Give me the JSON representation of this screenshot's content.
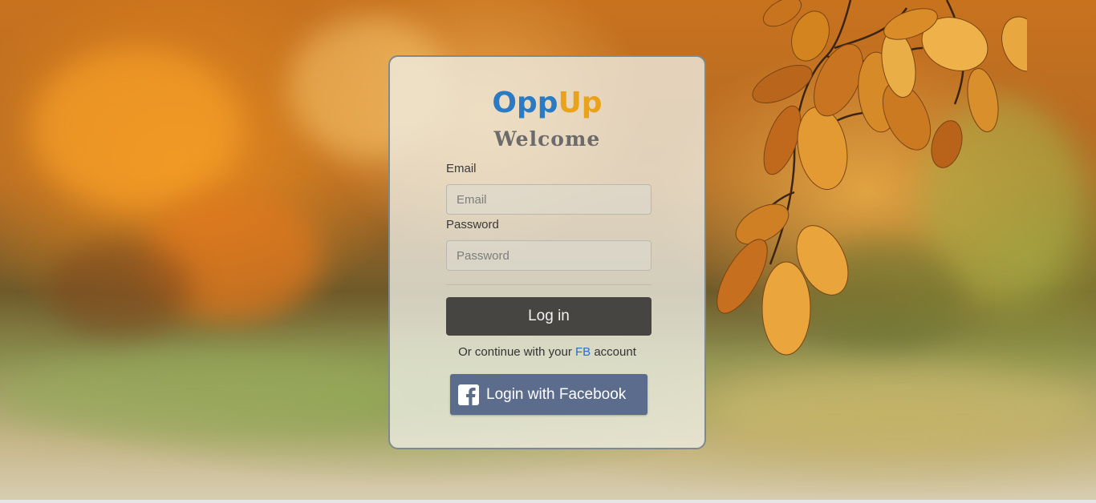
{
  "brand": {
    "part1": "Opp",
    "part2": "Up",
    "color1": "#2b7bc4",
    "color2": "#e9a21a"
  },
  "welcome": "Welcome",
  "form": {
    "email_label": "Email",
    "email_placeholder": "Email",
    "password_label": "Password",
    "password_placeholder": "Password",
    "login_label": "Log in"
  },
  "alt_login": {
    "prefix": "Or continue with your",
    "fb_link": "FB",
    "suffix": "account",
    "facebook_button": "Login with Facebook",
    "facebook_icon": "facebook-icon"
  }
}
